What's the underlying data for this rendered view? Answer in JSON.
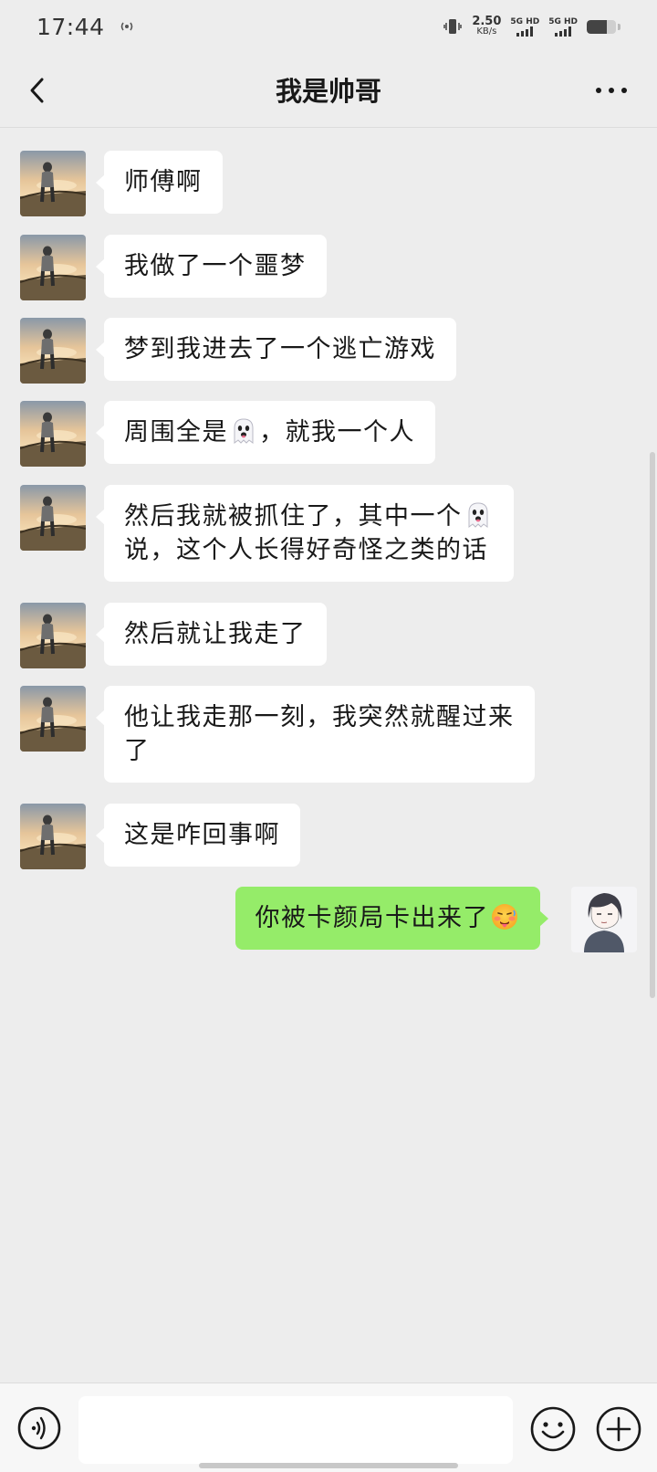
{
  "status_bar": {
    "time": "17:44",
    "net_speed_value": "2.50",
    "net_speed_unit": "KB/s",
    "sim1_label": "5G HD",
    "sim2_label": "5G HD",
    "battery_level": 0.7
  },
  "header": {
    "title": "我是帅哥"
  },
  "messages": [
    {
      "side": "left",
      "lines": [
        "师傅啊"
      ]
    },
    {
      "side": "left",
      "lines": [
        "我做了一个噩梦"
      ]
    },
    {
      "side": "left",
      "lines": [
        "梦到我进去了一个逃亡游戏"
      ]
    },
    {
      "side": "left",
      "lines": [
        "周围全是👻，就我一个人"
      ]
    },
    {
      "side": "left",
      "lines": [
        "然后我就被抓住了，其中一个👻",
        "说，这个人长得好奇怪之类的话"
      ]
    },
    {
      "side": "left",
      "lines": [
        "然后就让我走了"
      ]
    },
    {
      "side": "left",
      "lines": [
        "他让我走那一刻，我突然就醒过来",
        "了"
      ]
    },
    {
      "side": "left",
      "lines": [
        "这是咋回事啊"
      ]
    },
    {
      "side": "right",
      "lines": [
        "你被卡颜局卡出来了🥵"
      ]
    }
  ],
  "input_bar": {
    "placeholder": ""
  },
  "icons": {
    "back": "chevron-left-icon",
    "more": "more-dots-icon",
    "voice": "voice-icon",
    "emoji": "emoji-smile-icon",
    "plus": "plus-circle-icon",
    "ghost": "ghost-emoji",
    "face": "hot-face-emoji"
  },
  "colors": {
    "background": "#ededed",
    "bubble_left": "#ffffff",
    "bubble_right": "#95ec69"
  }
}
